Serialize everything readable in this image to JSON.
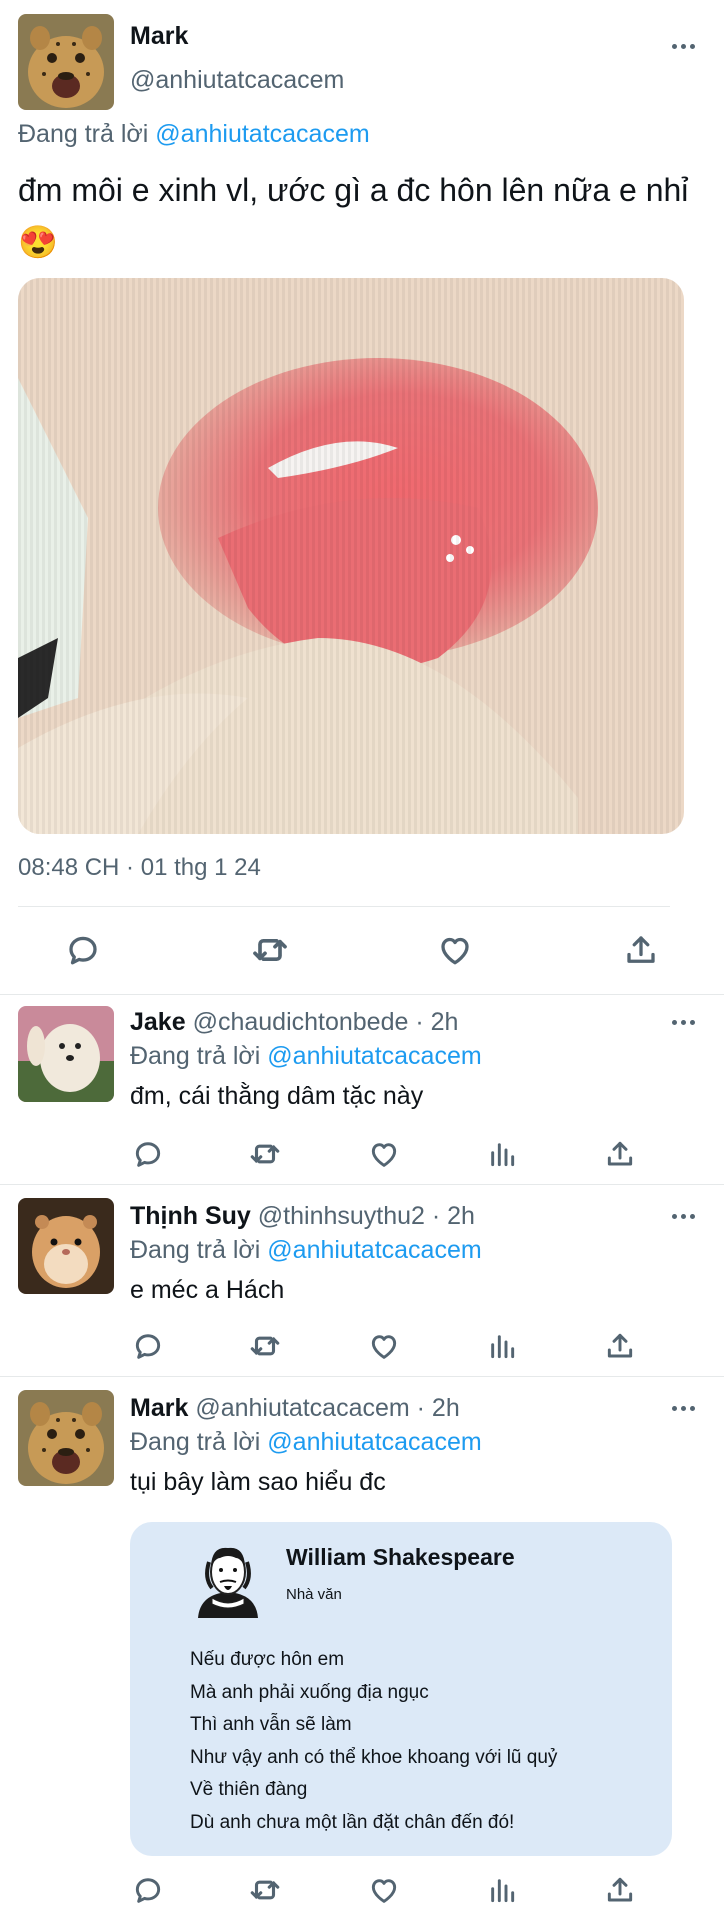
{
  "main_tweet": {
    "name": "Mark",
    "handle": "@anhiutatcacacem",
    "replying_prefix": "Đang trả lời",
    "replying_to": "@anhiutatcacacem",
    "text": "đm môi e xinh vl, ước gì a đc hôn lên nữa e nhỉ 😍",
    "timestamp": "08:48 CH · 01 thg 1 24",
    "avatar_icon": "cheetah-cub-avatar"
  },
  "replies": [
    {
      "name": "Jake",
      "handle": "@chaudichtonbede · 2h",
      "replying_prefix": "Đang trả lời",
      "replying_to": "@anhiutatcacacem",
      "text": "đm, cái thằng dâm tặc này",
      "avatar_icon": "white-dog-avatar"
    },
    {
      "name": "Thịnh Suy",
      "handle": "@thinhsuythu2 · 2h",
      "replying_prefix": "Đang trả lời",
      "replying_to": "@anhiutatcacacem",
      "text": "e méc a Hách",
      "avatar_icon": "hamster-avatar"
    },
    {
      "name": "Mark",
      "handle": "@anhiutatcacacem · 2h",
      "replying_prefix": "Đang trả lời",
      "replying_to": "@anhiutatcacacem",
      "text": "tụi bây làm sao hiểu đc",
      "avatar_icon": "cheetah-cub-avatar"
    }
  ],
  "quote_card": {
    "author": "William Shakespeare",
    "role": "Nhà văn",
    "lines": [
      "Nếu được hôn em",
      "Mà anh phải xuống địa ngục",
      "Thì anh vẫn sẽ làm",
      "Như vậy anh có thể khoe khoang với lũ quỷ",
      "Về thiên đàng",
      "Dù anh chưa một lần đặt chân đến đó!"
    ]
  },
  "icons": [
    "reply-icon",
    "retweet-icon",
    "like-icon",
    "views-icon",
    "share-icon",
    "more-icon"
  ],
  "colors": {
    "link": "#1d9bf0",
    "secondary_text": "#536471",
    "quote_bg": "#dce9f7"
  }
}
